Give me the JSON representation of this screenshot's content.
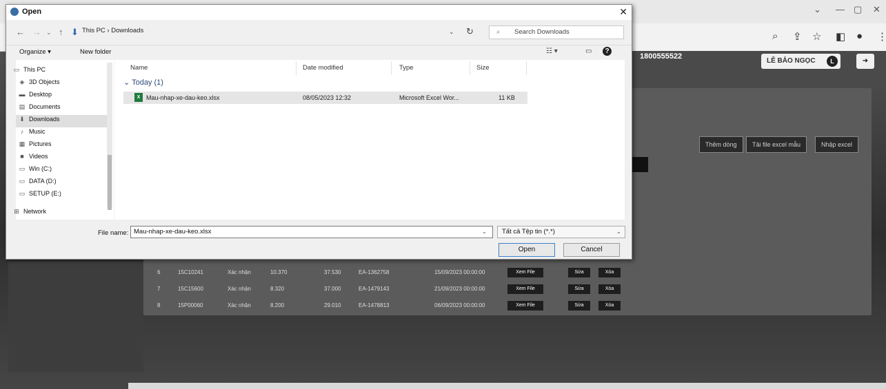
{
  "dialog": {
    "title": "Open",
    "breadcrumb": "This PC  ›  Downloads",
    "search_placeholder": "Search Downloads",
    "toolbar": {
      "organize": "Organize ▾",
      "new_folder": "New folder"
    },
    "nav": [
      {
        "label": "This PC",
        "icon": "computer-icon"
      },
      {
        "label": "3D Objects",
        "icon": "cube-icon"
      },
      {
        "label": "Desktop",
        "icon": "desktop-icon"
      },
      {
        "label": "Documents",
        "icon": "document-icon"
      },
      {
        "label": "Downloads",
        "icon": "download-icon",
        "selected": true
      },
      {
        "label": "Music",
        "icon": "music-icon"
      },
      {
        "label": "Pictures",
        "icon": "picture-icon"
      },
      {
        "label": "Videos",
        "icon": "video-icon"
      },
      {
        "label": "Win (C:)",
        "icon": "drive-icon"
      },
      {
        "label": "DATA (D:)",
        "icon": "drive-icon"
      },
      {
        "label": "SETUP (E:)",
        "icon": "drive-icon"
      },
      {
        "label": "Network",
        "icon": "network-icon"
      }
    ],
    "columns": {
      "name": "Name",
      "date": "Date modified",
      "type": "Type",
      "size": "Size"
    },
    "group": "Today (1)",
    "files": [
      {
        "name": "Mau-nhap-xe-dau-keo.xlsx",
        "date": "08/05/2023 12:32",
        "type": "Microsoft Excel Wor...",
        "size": "11 KB"
      }
    ],
    "file_name_label": "File name:",
    "file_name_value": "Mau-nhap-xe-dau-keo.xlsx",
    "file_type": "Tất cả Tệp tin (*.*)",
    "open_label": "Open",
    "cancel_label": "Cancel"
  },
  "site": {
    "hotline": "1800555522",
    "user_name": "LÊ BẢO NGỌC",
    "user_initial": "L",
    "buttons": [
      "Thêm dòng",
      "Tải file excel mẫu",
      "Nhập excel"
    ],
    "rows": [
      {
        "no": "6",
        "plate": "15C10241",
        "status": "Xác nhận",
        "c1": "10.370",
        "c2": "37.530",
        "code": "EA-1362758",
        "date": "15/09/2023 00:00:00"
      },
      {
        "no": "7",
        "plate": "15C15600",
        "status": "Xác nhận",
        "c1": "8.320",
        "c2": "37.000",
        "code": "EA-1479143",
        "date": "21/09/2023 00:00:00"
      },
      {
        "no": "8",
        "plate": "15P00060",
        "status": "Xác nhận",
        "c1": "8.200",
        "c2": "29.010",
        "code": "EA-1478813",
        "date": "06/09/2023 00:00:00"
      }
    ],
    "row_actions": {
      "view": "Xem File",
      "edit": "Sửa",
      "delete": "Xóa"
    }
  }
}
